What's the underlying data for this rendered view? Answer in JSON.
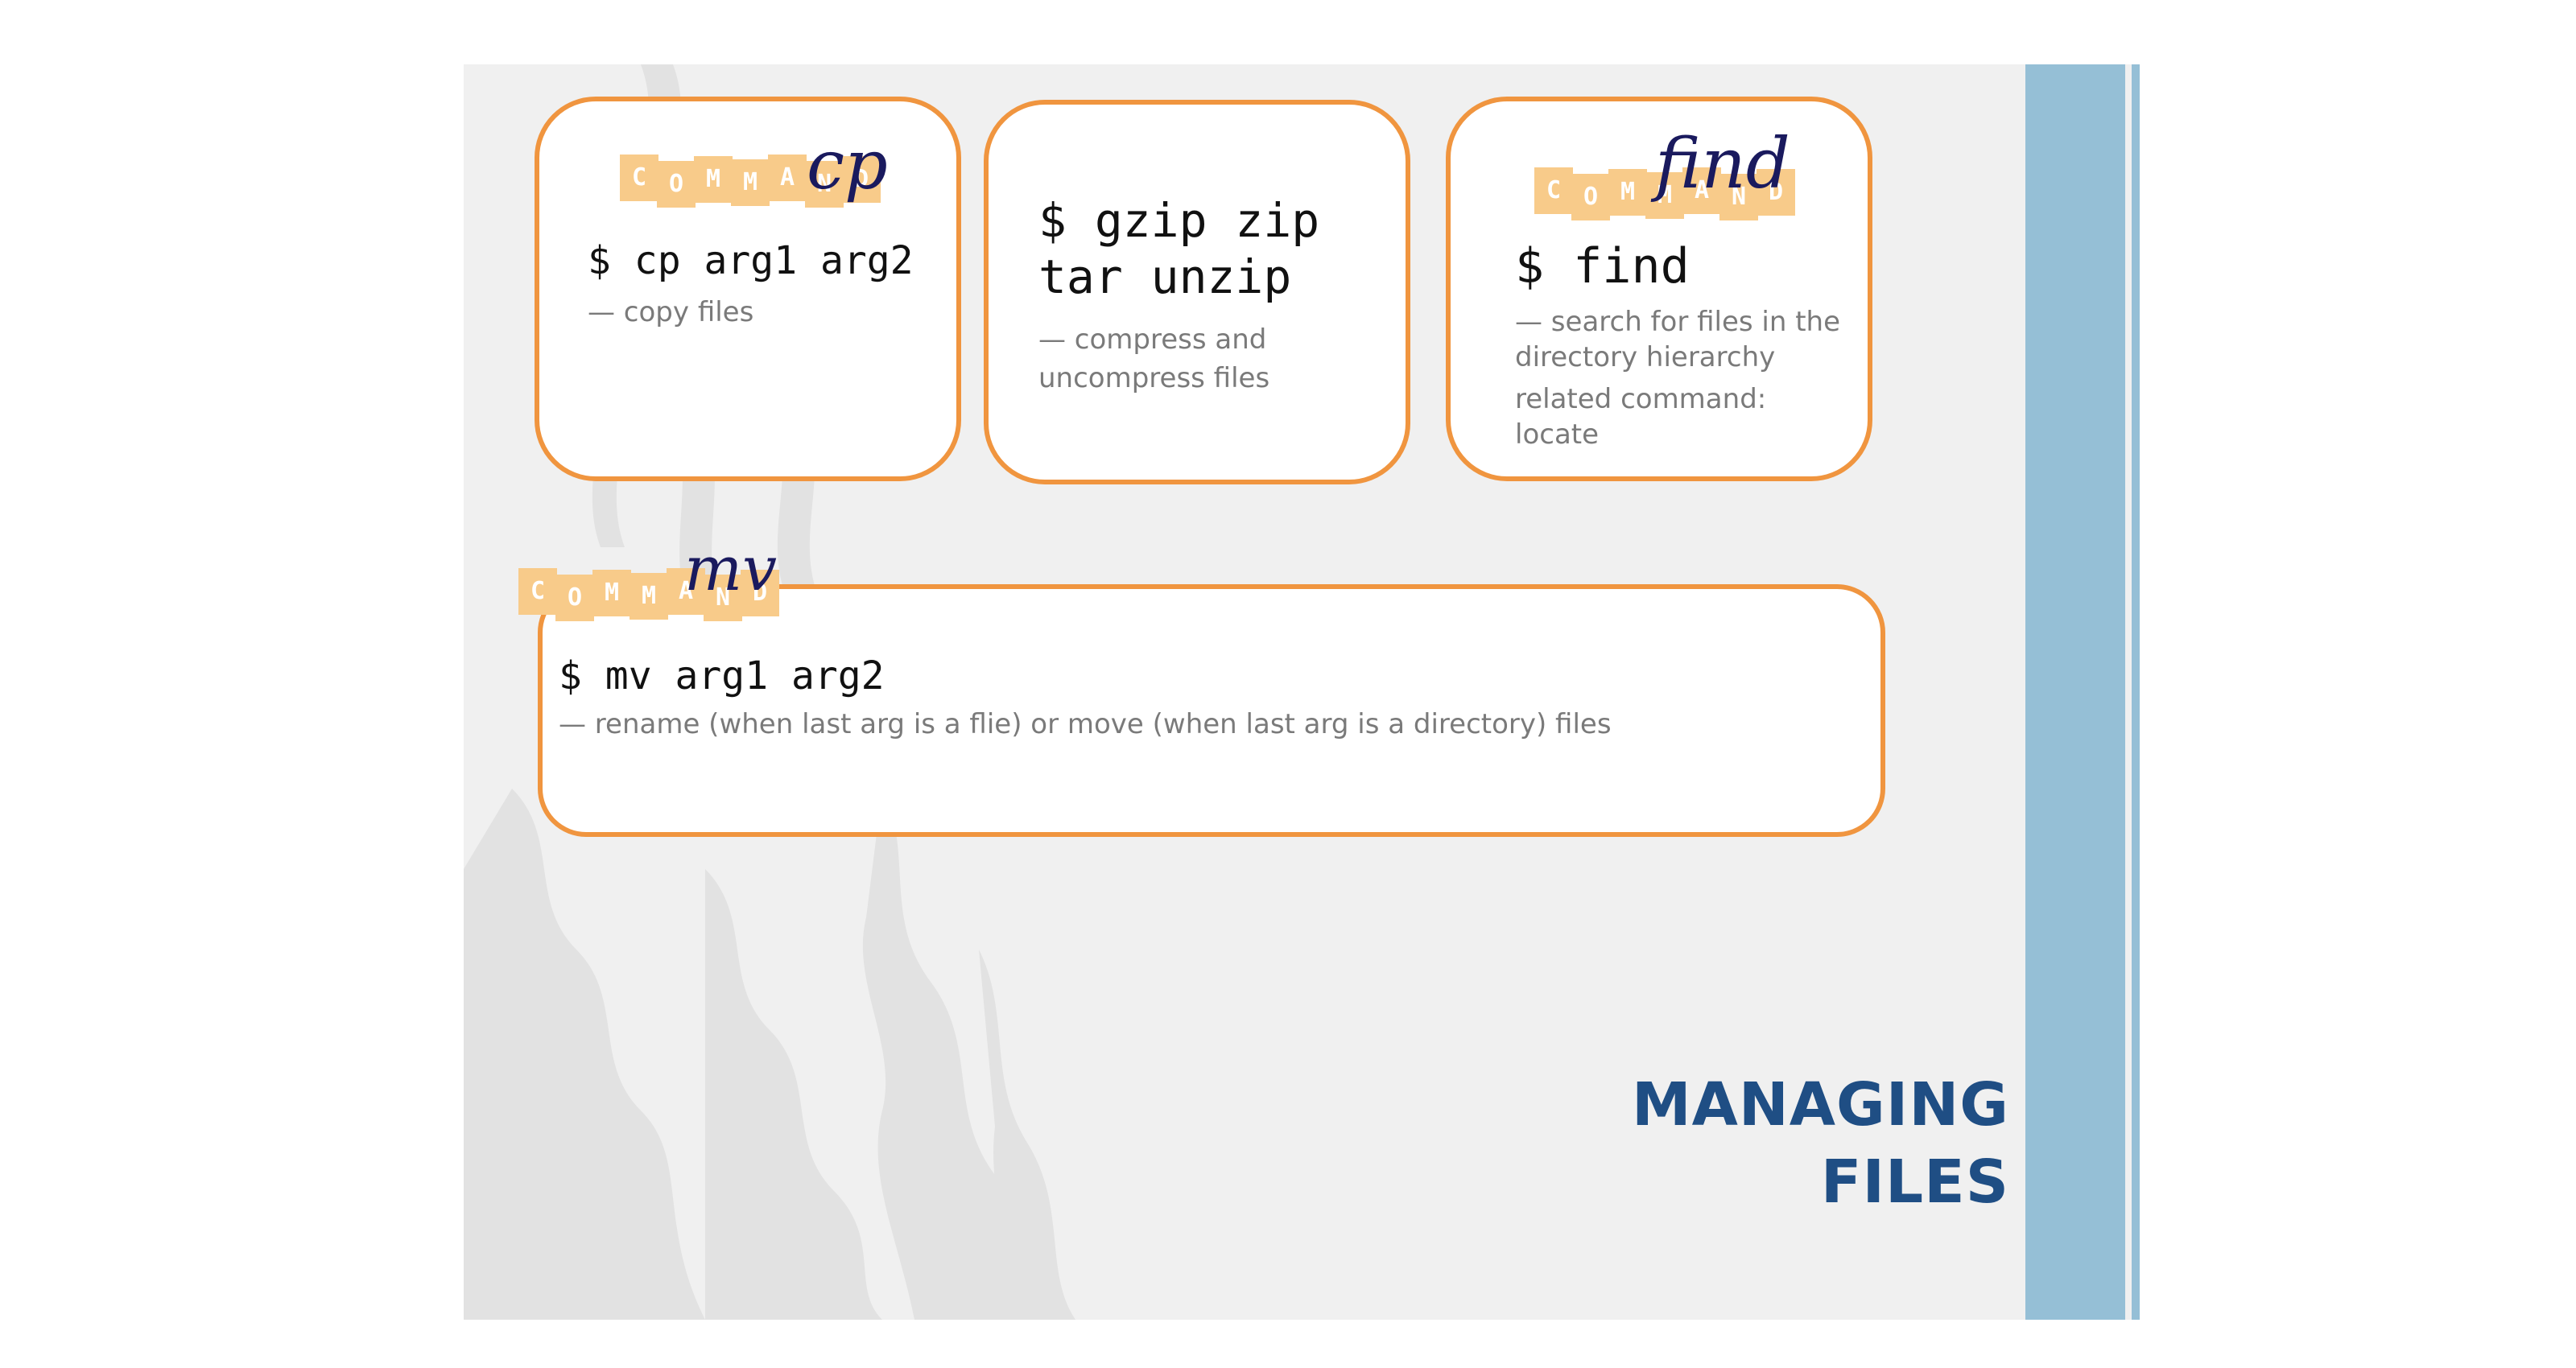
{
  "cards": {
    "cp": {
      "stamp_word": "cp",
      "command": "$ cp arg1 arg2",
      "description": "— copy files"
    },
    "gzip": {
      "command_line1": "$ gzip zip",
      "command_line2": "tar unzip",
      "description_line1": "— compress and",
      "description_line2": "uncompress files"
    },
    "find": {
      "stamp_word": "find",
      "command": "$ find",
      "description_line1": "— search for files in the",
      "description_line2": "directory hierarchy",
      "related_line1": "related command:",
      "related_line2": "locate"
    },
    "mv": {
      "stamp_word": "mv",
      "command": "$ mv arg1 arg2",
      "description": "— rename (when last arg is a flie) or move (when last arg is a directory) files"
    }
  },
  "stamp_letters": [
    "C",
    "O",
    "M",
    "M",
    "A",
    "N",
    "D"
  ],
  "title": {
    "line1": "MANAGING",
    "line2": "FILES"
  },
  "colors": {
    "card_border": "#f0953f",
    "title": "#1f4e84",
    "side_bar": "#95bfd6",
    "stamp_tile": "#f8cb8a"
  }
}
